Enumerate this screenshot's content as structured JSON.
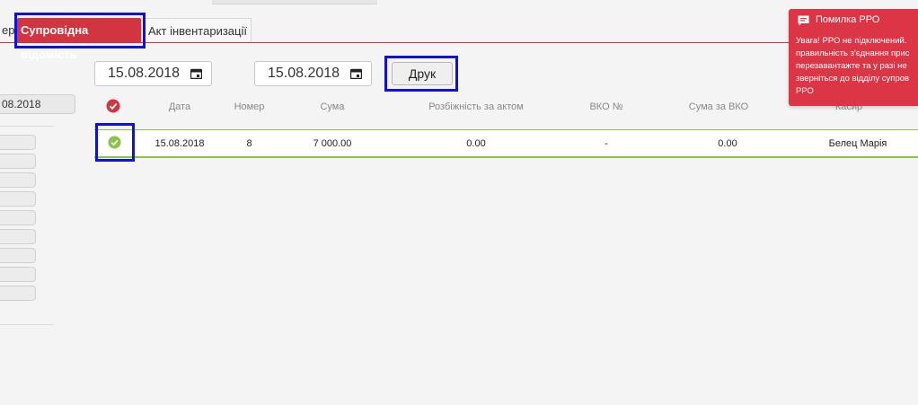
{
  "tabs": {
    "previous_label": "ер",
    "active_label": "Супровідна відомість",
    "inventory_label": "Акт інвентаризації"
  },
  "filters": {
    "date_from": "15.08.2018",
    "date_to": "15.08.2018",
    "print_label": "Друк"
  },
  "left_panel": {
    "date_value": "08.2018"
  },
  "table": {
    "columns": [
      "Дата",
      "Номер",
      "Сума",
      "Розбіжність за актом",
      "ВКО №",
      "Сума за ВКО",
      "Касир"
    ],
    "rows": [
      {
        "date": "15.08.2018",
        "number": "8",
        "sum": "7 000.00",
        "discrepancy": "0.00",
        "vko_no": "-",
        "vko_sum": "0.00",
        "cashier": "Белец Марія"
      }
    ]
  },
  "toast": {
    "title": "Помилка РРО",
    "body": "Увага! РРО не підключений.\nправильність з'єднання прис\nперезавантажте та у разі не\nзверніться до відділу супров\nРРО"
  },
  "colors": {
    "accent": "#d23540",
    "success": "#8bc34a",
    "toast_bg": "#dc3545"
  }
}
